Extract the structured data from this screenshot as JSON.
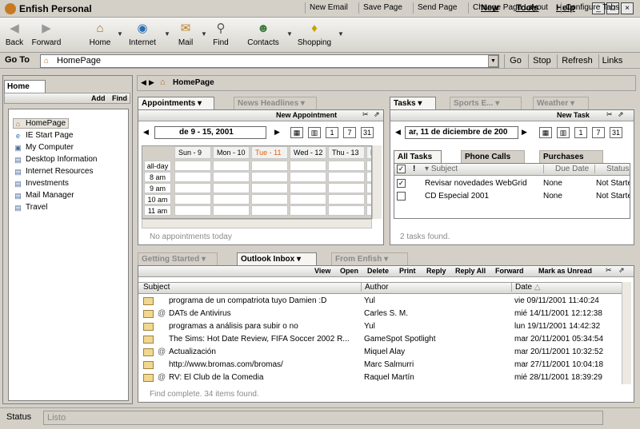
{
  "app": {
    "title": "Enfish Personal"
  },
  "menu": [
    "New",
    "Tools",
    "Help"
  ],
  "window_controls": [
    "_",
    "□",
    "×"
  ],
  "toolbar": {
    "back": "Back",
    "forward": "Forward",
    "home": "Home",
    "internet": "Internet",
    "mail": "Mail",
    "find": "Find",
    "contacts": "Contacts",
    "shopping": "Shopping"
  },
  "goto": {
    "label": "Go To",
    "value": "HomePage",
    "go": "Go",
    "stop": "Stop",
    "refresh": "Refresh",
    "links": "Links"
  },
  "left": {
    "header": "Home",
    "add": "Add",
    "find": "Find",
    "items": [
      "HomePage",
      "IE Start Page",
      "My Computer",
      "Desktop Information",
      "Internet Resources",
      "Investments",
      "Mail Manager",
      "Travel"
    ]
  },
  "main": {
    "title": "HomePage",
    "buttons": [
      "New Email",
      "Save Page",
      "Send Page",
      "Change Page Layout",
      "Configure Tabs"
    ]
  },
  "appointments": {
    "tabs": [
      "Appointments",
      "News Headlines"
    ],
    "new_label": "New Appointment",
    "date_range": "de 9 - 15, 2001",
    "days": [
      "Sun - 9",
      "Mon - 10",
      "Tue - 11",
      "Wed - 12",
      "Thu - 13",
      "Fri"
    ],
    "times": [
      "all-day",
      "8 am",
      "9 am",
      "10 am",
      "11 am"
    ],
    "status": "No appointments today"
  },
  "tasks": {
    "tabs": [
      "Tasks",
      "Sports E...",
      "Weather"
    ],
    "new_label": "New Task",
    "date": "ar, 11 de diciembre de 200",
    "subtabs": [
      "All Tasks",
      "Phone Calls",
      "Purchases"
    ],
    "columns": [
      "!",
      "Subject",
      "Due Date",
      "Status"
    ],
    "rows": [
      {
        "subject": "Revisar novedades WebGrid",
        "due": "None",
        "status": "Not Starte"
      },
      {
        "subject": "CD Especial 2001",
        "due": "None",
        "status": "Not Starte"
      }
    ],
    "status": "2 tasks found."
  },
  "inbox": {
    "tabs": [
      "Getting Started",
      "Outlook Inbox",
      "From Enfish"
    ],
    "actions": [
      "View",
      "Open",
      "Delete",
      "Print",
      "Reply",
      "Reply All",
      "Forward",
      "Mark as Unread"
    ],
    "columns": [
      "Subject",
      "Author",
      "Date"
    ],
    "rows": [
      {
        "subject": "programa de un compatriota tuyo Damien :D",
        "author": "Yul",
        "date": "vie 09/11/2001 11:40:24",
        "attach": false
      },
      {
        "subject": "DATs de Antivirus",
        "author": "Carles S. M.",
        "date": "mié 14/11/2001 12:12:38",
        "attach": true
      },
      {
        "subject": "programas a análisis para subir o no",
        "author": "Yul",
        "date": "lun 19/11/2001 14:42:32",
        "attach": false
      },
      {
        "subject": "The Sims: Hot Date Review, FIFA Soccer 2002 R...",
        "author": "GameSpot Spotlight",
        "date": "mar 20/11/2001 05:34:54",
        "attach": false
      },
      {
        "subject": "Actualización",
        "author": "Miquel Alay",
        "date": "mar 20/11/2001 10:32:52",
        "attach": true
      },
      {
        "subject": "http://www.bromas.com/bromas/",
        "author": "Marc Salmurri",
        "date": "mar 27/11/2001 10:04:18",
        "attach": false
      },
      {
        "subject": "RV: El Club de la Comedia",
        "author": "Raquel Martín",
        "date": "mié 28/11/2001 18:39:29",
        "attach": true
      }
    ],
    "status": "Find complete. 34 items found."
  },
  "statusbar": {
    "label": "Status",
    "value": "Listo"
  },
  "colors": {
    "accent": "#e06010",
    "tab_active_bg": "#f6f5f2",
    "chrome": "#d4d0c8"
  }
}
